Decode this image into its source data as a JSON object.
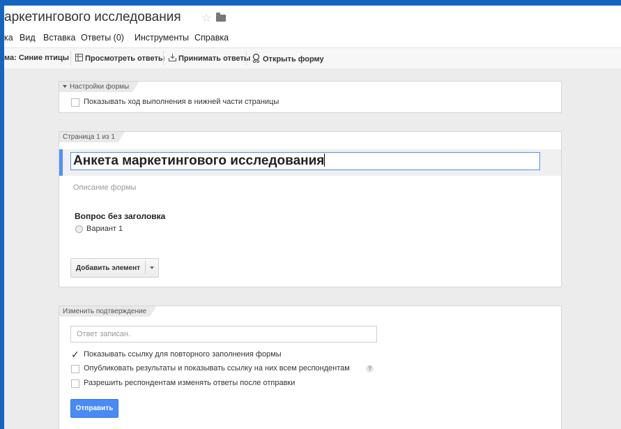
{
  "window": {
    "doc_title": "аркетингового исследования"
  },
  "menubar": {
    "items": [
      "ка",
      "Вид",
      "Вставка",
      "Ответы (0)",
      "Инструменты",
      "Справка"
    ]
  },
  "toolbar": {
    "theme_label": "ма: Синие птицы",
    "view_responses": "Просмотреть ответы",
    "accept_responses": "Принимать ответы",
    "open_form": "Открыть форму"
  },
  "settings": {
    "tag": "Настройки формы",
    "show_progress": "Показывать ход выполнения в нижней части страницы"
  },
  "page_card": {
    "tag": "Страница 1 из 1",
    "form_title": "Анкета маркетингового исследования",
    "description_placeholder": "Описание формы",
    "question_title": "Вопрос без заголовка",
    "option_1": "Вариант 1",
    "add_element": "Добавить элемент"
  },
  "confirmation": {
    "tag": "Изменить подтверждение",
    "message_placeholder": "Ответ записан.",
    "option_resubmit": "Показывать ссылку для повторного заполнения формы",
    "option_publish": "Опубликовать результаты и показывать ссылку на них всем респондентам",
    "option_edit": "Разрешить респондентам изменять ответы после отправки",
    "help_symbol": "?",
    "submit": "Отправить"
  },
  "colors": {
    "accent": "#4d90fe",
    "submit_button": "#4a8af4",
    "frame": "#1565c0"
  }
}
